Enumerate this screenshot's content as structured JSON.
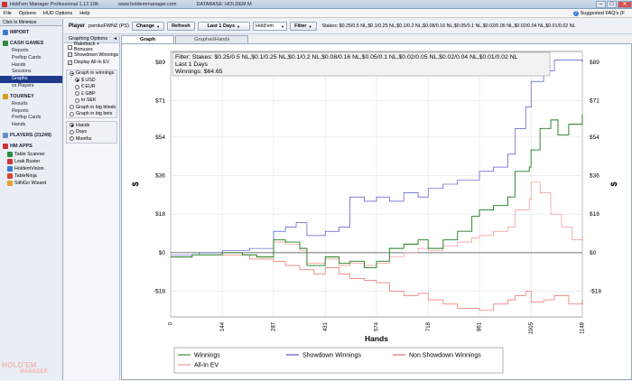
{
  "window": {
    "title": "Hold'em Manager Professional 1.12.10b",
    "url": "www.holdemmanager.com",
    "database": "DATABASE: HOLDEM M"
  },
  "menu": {
    "items": [
      "File",
      "Options",
      "HUD Options",
      "Help"
    ],
    "suggested": "Suggested FAQ's (F"
  },
  "sidebar": {
    "minimize": "Click to Minimize",
    "import": "IMPORT",
    "cash_games": "CASH GAMES",
    "cash_items": [
      "Reports",
      "Preflop Cards",
      "Hands",
      "Sessions",
      "Graphs",
      "vs Players"
    ],
    "selected_index": 4,
    "tourney": "TOURNEY",
    "tourney_items": [
      "Results",
      "Reports",
      "Preflop Cards",
      "Hands"
    ],
    "players": "PLAYERS (21249)",
    "hm_apps": "HM APPS",
    "app_items": [
      "Table Scanner",
      "Leak Buster",
      "HoldemVision",
      "TableNinja",
      "SitNGo Wizard"
    ],
    "logo": "HOLD'EM",
    "logo2": "MANAGER"
  },
  "playerbar": {
    "label": "Player",
    "name": "pornksFWNZ (PS)",
    "change": "Change",
    "refresh": "Refresh",
    "period": "Last 1 Days",
    "game": "Hold'em",
    "filter": "Filter",
    "stakes": "Stakes: $0.25/0.5 NL,$0.1/0.25 NL,$0.1/0.2 NL,$0.08/0.16 NL,$0.05/0.1 NL,$0.02/0.05 NL,$0.02/0.04 NL,$0.01/0.02 NL"
  },
  "graph_options": {
    "header": "Graphing Options",
    "checks": [
      {
        "label": "Rakeback + Bonuses",
        "checked": false
      },
      {
        "label": "Showdown Winnings",
        "checked": true
      },
      {
        "label": "Display All-In EV",
        "checked": true
      }
    ],
    "radios1": [
      {
        "label": "Graph in winnings",
        "on": true,
        "indent": false
      },
      {
        "label": "$ USD",
        "on": true,
        "indent": true
      },
      {
        "label": "€ EUR",
        "on": false,
        "indent": true
      },
      {
        "label": "£ GBP",
        "on": false,
        "indent": true
      },
      {
        "label": "kr SEK",
        "on": false,
        "indent": true
      },
      {
        "label": "Graph in big blinds",
        "on": false,
        "indent": false
      },
      {
        "label": "Graph in big bets",
        "on": false,
        "indent": false
      }
    ],
    "radios2": [
      {
        "label": "Hands",
        "on": true
      },
      {
        "label": "Days",
        "on": false
      },
      {
        "label": "Months",
        "on": false
      }
    ]
  },
  "tabs": [
    {
      "label": "Graph",
      "active": true
    },
    {
      "label": "GraphedHands",
      "active": false
    }
  ],
  "chart_data": {
    "type": "line",
    "info_lines": [
      "Filter: Stakes: $0.25/0.5 NL,$0.1/0.25 NL,$0.1/0.2 NL,$0.08/0.16 NL,$0.05/0.1 NL,$0.02/0.05 NL,$0.02/0.04 NL,$0.01/0.02 NL",
      "Last  1 Days",
      "Winnings: $64.65"
    ],
    "xlabel": "Hands",
    "ylabel": "$",
    "xlim": [
      0,
      1148
    ],
    "ylim": [
      -30,
      94
    ],
    "x_ticks": [
      0,
      144,
      287,
      431,
      574,
      718,
      861,
      1005,
      1148
    ],
    "y_ticks": [
      -18,
      0,
      18,
      36,
      54,
      71,
      89
    ],
    "y_tick_labels": [
      "-$18",
      "$0",
      "$18",
      "$36",
      "$54",
      "$71",
      "$89"
    ],
    "grid": true,
    "legend_placement": "bottom",
    "series": [
      {
        "name": "Winnings",
        "color": "#1a7a1a",
        "points": [
          [
            0,
            -2
          ],
          [
            60,
            -1
          ],
          [
            144,
            0
          ],
          [
            200,
            -1
          ],
          [
            240,
            -2
          ],
          [
            287,
            6
          ],
          [
            320,
            5
          ],
          [
            360,
            2
          ],
          [
            380,
            -6
          ],
          [
            431,
            -2
          ],
          [
            470,
            -5
          ],
          [
            500,
            -4
          ],
          [
            540,
            -7
          ],
          [
            574,
            -4
          ],
          [
            610,
            2
          ],
          [
            650,
            4
          ],
          [
            690,
            6
          ],
          [
            718,
            2
          ],
          [
            760,
            6
          ],
          [
            800,
            10
          ],
          [
            840,
            17
          ],
          [
            861,
            20
          ],
          [
            900,
            22
          ],
          [
            940,
            26
          ],
          [
            960,
            38
          ],
          [
            1000,
            40
          ],
          [
            1005,
            48
          ],
          [
            1030,
            58
          ],
          [
            1060,
            62
          ],
          [
            1080,
            55
          ],
          [
            1110,
            60
          ],
          [
            1148,
            64.65
          ]
        ]
      },
      {
        "name": "Showdown Winnings",
        "color": "#3333cc",
        "points": [
          [
            0,
            -1
          ],
          [
            80,
            0
          ],
          [
            144,
            1
          ],
          [
            220,
            2
          ],
          [
            287,
            10
          ],
          [
            320,
            12
          ],
          [
            350,
            14
          ],
          [
            380,
            8
          ],
          [
            431,
            10
          ],
          [
            470,
            12
          ],
          [
            500,
            26
          ],
          [
            540,
            24
          ],
          [
            574,
            26
          ],
          [
            610,
            24
          ],
          [
            650,
            28
          ],
          [
            690,
            26
          ],
          [
            718,
            30
          ],
          [
            760,
            32
          ],
          [
            800,
            34
          ],
          [
            861,
            38
          ],
          [
            900,
            40
          ],
          [
            940,
            46
          ],
          [
            961,
            58
          ],
          [
            990,
            68
          ],
          [
            1005,
            80
          ],
          [
            1040,
            85
          ],
          [
            1070,
            90
          ],
          [
            1148,
            89
          ]
        ]
      },
      {
        "name": "Non Showdown Winnings",
        "color": "#e8524a",
        "points": [
          [
            0,
            -1
          ],
          [
            60,
            -1
          ],
          [
            144,
            -1
          ],
          [
            220,
            -3
          ],
          [
            287,
            -4
          ],
          [
            320,
            -6
          ],
          [
            360,
            -8
          ],
          [
            400,
            -10
          ],
          [
            431,
            -7
          ],
          [
            470,
            -10
          ],
          [
            500,
            -12
          ],
          [
            540,
            -13
          ],
          [
            574,
            -14
          ],
          [
            610,
            -18
          ],
          [
            650,
            -20
          ],
          [
            690,
            -19
          ],
          [
            718,
            -22
          ],
          [
            760,
            -24
          ],
          [
            800,
            -26
          ],
          [
            861,
            -27
          ],
          [
            900,
            -24
          ],
          [
            940,
            -22
          ],
          [
            961,
            -20
          ],
          [
            990,
            -18
          ],
          [
            1005,
            -23
          ],
          [
            1040,
            -22
          ],
          [
            1070,
            -20
          ],
          [
            1110,
            -24
          ],
          [
            1148,
            -22
          ]
        ]
      },
      {
        "name": "All-In EV",
        "color": "#f08080",
        "points": [
          [
            0,
            -2
          ],
          [
            60,
            -1
          ],
          [
            144,
            0
          ],
          [
            200,
            -1
          ],
          [
            240,
            -2
          ],
          [
            287,
            5
          ],
          [
            320,
            4
          ],
          [
            360,
            1
          ],
          [
            380,
            -5
          ],
          [
            431,
            -3
          ],
          [
            470,
            -6
          ],
          [
            500,
            -5
          ],
          [
            540,
            -6
          ],
          [
            574,
            -5
          ],
          [
            610,
            -2
          ],
          [
            650,
            0
          ],
          [
            690,
            2
          ],
          [
            718,
            1
          ],
          [
            760,
            3
          ],
          [
            800,
            5
          ],
          [
            840,
            7
          ],
          [
            861,
            8
          ],
          [
            900,
            10
          ],
          [
            940,
            12
          ],
          [
            960,
            20
          ],
          [
            1000,
            25
          ],
          [
            1005,
            33
          ],
          [
            1030,
            28
          ],
          [
            1060,
            18
          ],
          [
            1090,
            12
          ],
          [
            1120,
            6
          ],
          [
            1148,
            8
          ]
        ]
      }
    ]
  }
}
